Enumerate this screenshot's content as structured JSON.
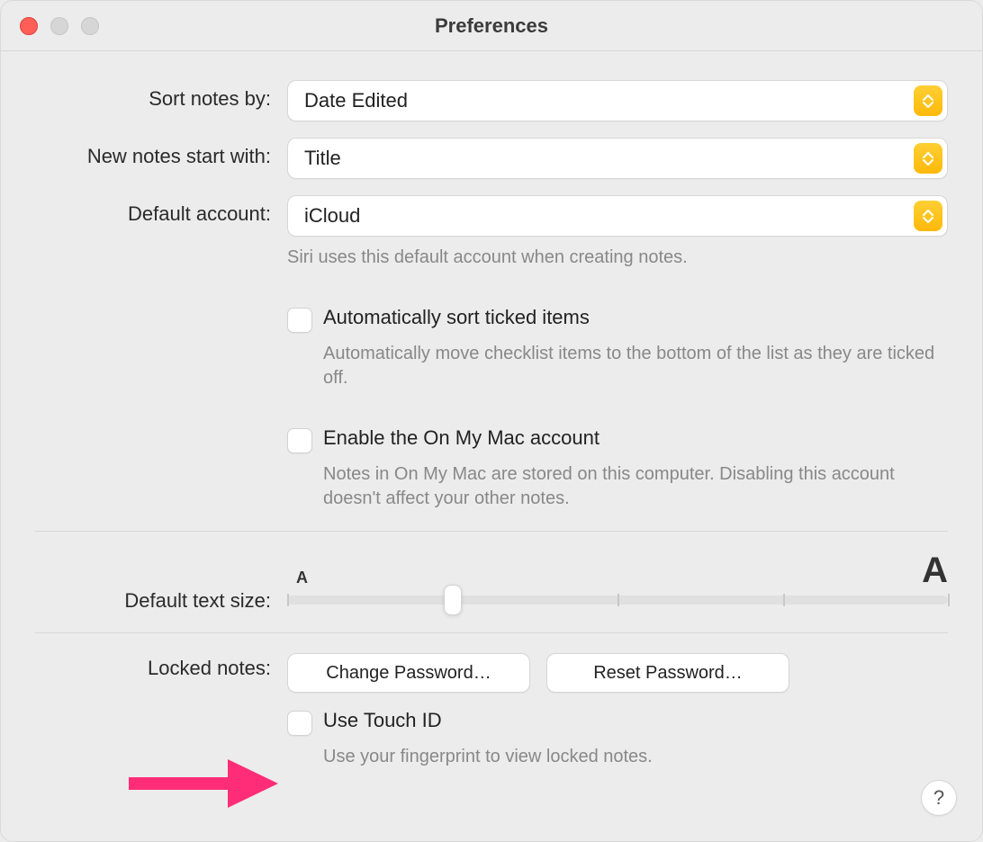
{
  "window": {
    "title": "Preferences"
  },
  "sort_notes": {
    "label": "Sort notes by:",
    "value": "Date Edited"
  },
  "new_notes": {
    "label": "New notes start with:",
    "value": "Title"
  },
  "default_account": {
    "label": "Default account:",
    "value": "iCloud",
    "help": "Siri uses this default account when creating notes."
  },
  "auto_sort": {
    "label": "Automatically sort ticked items",
    "help": "Automatically move checklist items to the bottom of the list as they are ticked off.",
    "checked": false
  },
  "on_my_mac": {
    "label": "Enable the On My Mac account",
    "help": "Notes in On My Mac are stored on this computer. Disabling this account doesn't affect your other notes.",
    "checked": false
  },
  "text_size": {
    "label": "Default text size:",
    "small_glyph": "A",
    "large_glyph": "A",
    "value": 1,
    "min": 0,
    "max": 4
  },
  "locked_notes": {
    "label": "Locked notes:",
    "change_password_label": "Change Password…",
    "reset_password_label": "Reset Password…"
  },
  "touch_id": {
    "label": "Use Touch ID",
    "help": "Use your fingerprint to view locked notes.",
    "checked": false
  },
  "help_button": {
    "glyph": "?"
  }
}
